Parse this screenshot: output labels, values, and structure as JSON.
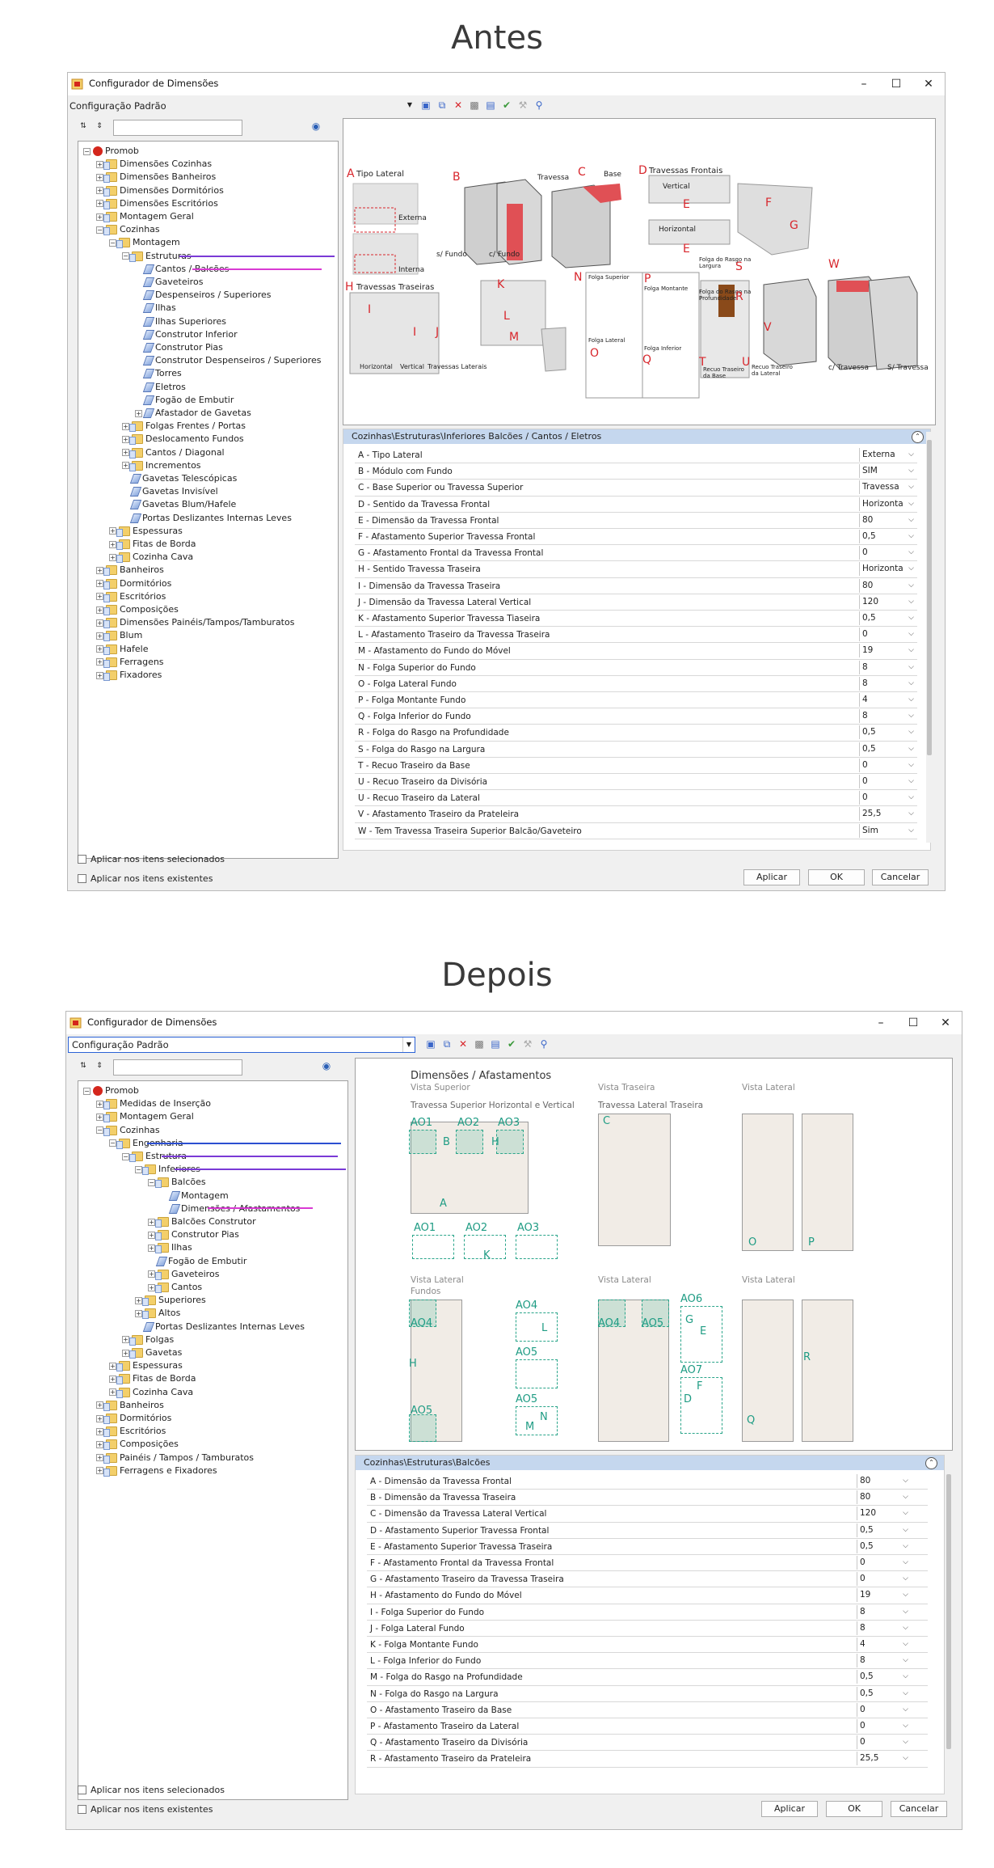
{
  "before": {
    "heading": "Antes",
    "window_title": "Configurador de Dimensões",
    "config_label": "Configuração Padrão",
    "tree": [
      {
        "label": "Promob",
        "level": 0,
        "toggle": "-",
        "icon": "root"
      },
      {
        "label": "Dimensões Cozinhas",
        "level": 1,
        "toggle": "+",
        "icon": "folder"
      },
      {
        "label": "Dimensões Banheiros",
        "level": 1,
        "toggle": "+",
        "icon": "folder"
      },
      {
        "label": "Dimensões Dormitórios",
        "level": 1,
        "toggle": "+",
        "icon": "folder"
      },
      {
        "label": "Dimensões Escritórios",
        "level": 1,
        "toggle": "+",
        "icon": "folder"
      },
      {
        "label": "Montagem Geral",
        "level": 1,
        "toggle": "+",
        "icon": "folder"
      },
      {
        "label": "Cozinhas",
        "level": 1,
        "toggle": "-",
        "icon": "folder"
      },
      {
        "label": "Montagem",
        "level": 2,
        "toggle": "-",
        "icon": "folder"
      },
      {
        "label": "Estruturas",
        "level": 3,
        "toggle": "-",
        "icon": "folder"
      },
      {
        "label": "Cantos / Balcões",
        "level": 4,
        "toggle": "",
        "icon": "leaf"
      },
      {
        "label": "Gaveteiros",
        "level": 4,
        "toggle": "",
        "icon": "leaf"
      },
      {
        "label": "Despenseiros / Superiores",
        "level": 4,
        "toggle": "",
        "icon": "leaf"
      },
      {
        "label": "Ilhas",
        "level": 4,
        "toggle": "",
        "icon": "leaf"
      },
      {
        "label": "Ilhas Superiores",
        "level": 4,
        "toggle": "",
        "icon": "leaf"
      },
      {
        "label": "Construtor Inferior",
        "level": 4,
        "toggle": "",
        "icon": "leaf"
      },
      {
        "label": "Construtor Pias",
        "level": 4,
        "toggle": "",
        "icon": "leaf"
      },
      {
        "label": "Construtor Despenseiros / Superiores",
        "level": 4,
        "toggle": "",
        "icon": "leaf"
      },
      {
        "label": "Torres",
        "level": 4,
        "toggle": "",
        "icon": "leaf"
      },
      {
        "label": "Eletros",
        "level": 4,
        "toggle": "",
        "icon": "leaf"
      },
      {
        "label": "Fogão de Embutir",
        "level": 4,
        "toggle": "",
        "icon": "leaf"
      },
      {
        "label": "Afastador de Gavetas",
        "level": 4,
        "toggle": "+",
        "icon": "leaf"
      },
      {
        "label": "Folgas Frentes / Portas",
        "level": 3,
        "toggle": "+",
        "icon": "folder"
      },
      {
        "label": "Deslocamento Fundos",
        "level": 3,
        "toggle": "+",
        "icon": "folder"
      },
      {
        "label": "Cantos / Diagonal",
        "level": 3,
        "toggle": "+",
        "icon": "folder"
      },
      {
        "label": "Incrementos",
        "level": 3,
        "toggle": "+",
        "icon": "folder"
      },
      {
        "label": "Gavetas Telescópicas",
        "level": 3,
        "toggle": "",
        "icon": "leaf"
      },
      {
        "label": "Gavetas Invisível",
        "level": 3,
        "toggle": "",
        "icon": "leaf"
      },
      {
        "label": "Gavetas Blum/Hafele",
        "level": 3,
        "toggle": "",
        "icon": "leaf"
      },
      {
        "label": "Portas Deslizantes Internas Leves",
        "level": 3,
        "toggle": "",
        "icon": "leaf"
      },
      {
        "label": "Espessuras",
        "level": 2,
        "toggle": "+",
        "icon": "folder"
      },
      {
        "label": "Fitas de Borda",
        "level": 2,
        "toggle": "+",
        "icon": "folder"
      },
      {
        "label": "Cozinha Cava",
        "level": 2,
        "toggle": "+",
        "icon": "folder"
      },
      {
        "label": "Banheiros",
        "level": 1,
        "toggle": "+",
        "icon": "folder"
      },
      {
        "label": "Dormitórios",
        "level": 1,
        "toggle": "+",
        "icon": "folder"
      },
      {
        "label": "Escritórios",
        "level": 1,
        "toggle": "+",
        "icon": "folder"
      },
      {
        "label": "Composições",
        "level": 1,
        "toggle": "+",
        "icon": "folder"
      },
      {
        "label": "Dimensões Painéis/Tampos/Tamburatos",
        "level": 1,
        "toggle": "+",
        "icon": "folder"
      },
      {
        "label": "Blum",
        "level": 1,
        "toggle": "+",
        "icon": "folder"
      },
      {
        "label": "Hafele",
        "level": 1,
        "toggle": "+",
        "icon": "folder"
      },
      {
        "label": "Ferragens",
        "level": 1,
        "toggle": "+",
        "icon": "folder"
      },
      {
        "label": "Fixadores",
        "level": 1,
        "toggle": "+",
        "icon": "folder"
      }
    ],
    "grid_header": "Cozinhas\\Estruturas\\Inferiores Balcões / Cantos / Eletros",
    "rows": [
      {
        "label": "A - Tipo Lateral",
        "value": "Externa"
      },
      {
        "label": "B - Módulo com Fundo",
        "value": "SIM"
      },
      {
        "label": "C - Base Superior ou Travessa Superior",
        "value": "Travessa"
      },
      {
        "label": "D - Sentido da Travessa Frontal",
        "value": "Horizonta"
      },
      {
        "label": "E - Dimensão da Travessa Frontal",
        "value": "80"
      },
      {
        "label": "F - Afastamento Superior Travessa Frontal",
        "value": "0,5"
      },
      {
        "label": "G - Afastamento Frontal da Travessa Frontal",
        "value": "0"
      },
      {
        "label": "H - Sentido Travessa Traseira",
        "value": "Horizonta"
      },
      {
        "label": "I - Dimensão da Travessa Traseira",
        "value": "80"
      },
      {
        "label": "J - Dimensão da Travessa Lateral Vertical",
        "value": "120"
      },
      {
        "label": "K - Afastamento Superior Travessa Tiaseira",
        "value": "0,5"
      },
      {
        "label": "L - Afastamento Traseiro da Travessa Traseira",
        "value": "0"
      },
      {
        "label": "M - Afastamento do Fundo do Móvel",
        "value": "19"
      },
      {
        "label": "N - Folga Superior do Fundo",
        "value": "8"
      },
      {
        "label": "O - Folga Lateral Fundo",
        "value": "8"
      },
      {
        "label": "P - Folga Montante Fundo",
        "value": "4"
      },
      {
        "label": "Q - Folga Inferior do Fundo",
        "value": "8"
      },
      {
        "label": "R - Folga do Rasgo na Profundidade",
        "value": "0,5"
      },
      {
        "label": "S - Folga do Rasgo na Largura",
        "value": "0,5"
      },
      {
        "label": "T - Recuo Traseiro da Base",
        "value": "0"
      },
      {
        "label": "U - Recuo Traseiro da Divisória",
        "value": "0"
      },
      {
        "label": "U - Recuo Traseiro da Lateral",
        "value": "0"
      },
      {
        "label": "V - Afastamento Traseiro da Prateleira",
        "value": "25,5"
      },
      {
        "label": "W - Tem Travessa Traseira Superior Balcão/Gaveteiro",
        "value": "Sim"
      }
    ],
    "preview": {
      "A": "A",
      "tipo_lateral": "Tipo Lateral",
      "externa": "Externa",
      "interna": "Interna",
      "B": "B",
      "s_fundo": "s/ Fundo",
      "c_fundo": "c/ Fundo",
      "C": "C",
      "travessa": "Travessa",
      "base": "Base",
      "D": "D",
      "travessas_frontais": "Travessas Frontais",
      "vertical": "Vertical",
      "horizontal": "Horizontal",
      "E1": "E",
      "E2": "E",
      "F": "F",
      "G": "G",
      "H": "H",
      "travessas_traseiras": "Travessas Traseiras",
      "I1": "I",
      "I2": "I",
      "J": "J",
      "t_horizontal": "Horizontal",
      "t_vertical": "Vertical",
      "t_laterais": "Travessas Laterais",
      "K": "K",
      "L": "L",
      "M": "M",
      "N": "N",
      "P": "P",
      "folga_superior": "Folga Superior",
      "folga_montante": "Folga Montante",
      "folga_lateral": "Folga Lateral",
      "folga_inferior": "Folga Inferior",
      "O": "O",
      "Q": "Q",
      "S": "S",
      "R": "R",
      "folga_rasgo_largura": "Folga do Rasgo na Largura",
      "folga_rasgo_prof": "Folga do Rasgo na Profundidade",
      "T": "T",
      "U": "U",
      "recuo_base": "Recuo Traseiro da Base",
      "recuo_lateral": "Recuo Traseiro da Lateral",
      "V": "V",
      "W": "W",
      "c_travessa": "c/ Travessa",
      "s_travessa": "S/ Travessa"
    },
    "check1": "Aplicar nos itens selecionados",
    "check2": "Aplicar nos itens existentes",
    "btn_apply": "Aplicar",
    "btn_ok": "OK",
    "btn_cancel": "Cancelar"
  },
  "after": {
    "heading": "Depois",
    "window_title": "Configurador de Dimensões",
    "config_label": "Configuração Padrão",
    "tree": [
      {
        "label": "Promob",
        "level": 0,
        "toggle": "-",
        "icon": "root"
      },
      {
        "label": "Medidas de Inserção",
        "level": 1,
        "toggle": "+",
        "icon": "folder"
      },
      {
        "label": "Montagem Geral",
        "level": 1,
        "toggle": "+",
        "icon": "folder"
      },
      {
        "label": "Cozinhas",
        "level": 1,
        "toggle": "-",
        "icon": "folder"
      },
      {
        "label": "Engenharia",
        "level": 2,
        "toggle": "-",
        "icon": "folder"
      },
      {
        "label": "Estrutura",
        "level": 3,
        "toggle": "-",
        "icon": "folder"
      },
      {
        "label": "Inferiores",
        "level": 4,
        "toggle": "-",
        "icon": "folder"
      },
      {
        "label": "Balcões",
        "level": 5,
        "toggle": "-",
        "icon": "folder"
      },
      {
        "label": "Montagem",
        "level": 6,
        "toggle": "",
        "icon": "leaf"
      },
      {
        "label": "Dimensões / Afastamentos",
        "level": 6,
        "toggle": "",
        "icon": "leaf"
      },
      {
        "label": "Balcões Construtor",
        "level": 5,
        "toggle": "+",
        "icon": "folder"
      },
      {
        "label": "Construtor Pias",
        "level": 5,
        "toggle": "+",
        "icon": "folder"
      },
      {
        "label": "Ilhas",
        "level": 5,
        "toggle": "+",
        "icon": "folder"
      },
      {
        "label": "Fogão de Embutir",
        "level": 5,
        "toggle": "",
        "icon": "leaf"
      },
      {
        "label": "Gaveteiros",
        "level": 5,
        "toggle": "+",
        "icon": "folder"
      },
      {
        "label": "Cantos",
        "level": 5,
        "toggle": "+",
        "icon": "folder"
      },
      {
        "label": "Superiores",
        "level": 4,
        "toggle": "+",
        "icon": "folder"
      },
      {
        "label": "Altos",
        "level": 4,
        "toggle": "+",
        "icon": "folder"
      },
      {
        "label": "Portas Deslizantes Internas Leves",
        "level": 4,
        "toggle": "",
        "icon": "leaf"
      },
      {
        "label": "Folgas",
        "level": 3,
        "toggle": "+",
        "icon": "folder"
      },
      {
        "label": "Gavetas",
        "level": 3,
        "toggle": "+",
        "icon": "folder"
      },
      {
        "label": "Espessuras",
        "level": 2,
        "toggle": "+",
        "icon": "folder"
      },
      {
        "label": "Fitas de Borda",
        "level": 2,
        "toggle": "+",
        "icon": "folder"
      },
      {
        "label": "Cozinha Cava",
        "level": 2,
        "toggle": "+",
        "icon": "folder"
      },
      {
        "label": "Banheiros",
        "level": 1,
        "toggle": "+",
        "icon": "folder"
      },
      {
        "label": "Dormitórios",
        "level": 1,
        "toggle": "+",
        "icon": "folder"
      },
      {
        "label": "Escritórios",
        "level": 1,
        "toggle": "+",
        "icon": "folder"
      },
      {
        "label": "Composições",
        "level": 1,
        "toggle": "+",
        "icon": "folder"
      },
      {
        "label": "Painéis / Tampos / Tamburatos",
        "level": 1,
        "toggle": "+",
        "icon": "folder"
      },
      {
        "label": "Ferragens e  Fixadores",
        "level": 1,
        "toggle": "+",
        "icon": "folder"
      }
    ],
    "grid_header": "Cozinhas\\Estruturas\\Balcões",
    "rows": [
      {
        "label": "A - Dimensão da Travessa Frontal",
        "value": "80"
      },
      {
        "label": "B - Dimensão da Travessa Traseira",
        "value": "80"
      },
      {
        "label": "C - Dimensão da Travessa Lateral Vertical",
        "value": "120"
      },
      {
        "label": "D - Afastamento Superior Travessa Frontal",
        "value": "0,5"
      },
      {
        "label": "E - Afastamento Superior Travessa Traseira",
        "value": "0,5"
      },
      {
        "label": "F - Afastamento Frontal da Travessa Frontal",
        "value": "0"
      },
      {
        "label": "G - Afastamento Traseiro da Travessa Traseira",
        "value": "0"
      },
      {
        "label": "H - Afastamento do Fundo do Móvel",
        "value": "19"
      },
      {
        "label": "I - Folga Superior do Fundo",
        "value": "8"
      },
      {
        "label": "J - Folga Lateral Fundo",
        "value": "8"
      },
      {
        "label": "K - Folga Montante Fundo",
        "value": "4"
      },
      {
        "label": "L - Folga Inferior do Fundo",
        "value": "8"
      },
      {
        "label": "M - Folga do Rasgo na Profundidade",
        "value": "0,5"
      },
      {
        "label": "N - Folga do Rasgo na Largura",
        "value": "0,5"
      },
      {
        "label": "O - Afastamento Traseiro da Base",
        "value": "0"
      },
      {
        "label": "P - Afastamento Traseiro da Lateral",
        "value": "0"
      },
      {
        "label": "Q - Afastamento Traseiro da Divisória",
        "value": "0"
      },
      {
        "label": "R - Afastamento Traseiro da Prateleira",
        "value": "25,5"
      }
    ],
    "preview": {
      "title": "Dimensões / Afastamentos",
      "vista_superior": "Vista Superior",
      "vista_traseira": "Vista Traseira",
      "vista_lateral": "Vista Lateral",
      "travessa_sup": "Travessa Superior Horizontal e Vertical",
      "travessa_lat": "Travessa Lateral Traseira",
      "vista_lateral_fundos": "Vista Lateral",
      "fundos": "Fundos",
      "vista_lateral2": "Vista Lateral",
      "vista_lateral3": "Vista Lateral",
      "AO1": "AO1",
      "AO2": "AO2",
      "AO3": "AO3",
      "B": "B",
      "H": "H",
      "A": "A",
      "C": "C",
      "O": "O",
      "P": "P",
      "AO1b": "AO1",
      "AO2b": "AO2",
      "AO3b": "AO3",
      "K": "K",
      "AO4": "AO4",
      "AO5": "AO5",
      "AO4b": "AO4",
      "AO5b": "AO5",
      "AO5c": "AO5",
      "AO4c": "AO4",
      "AO5d": "AO5",
      "AO6": "AO6",
      "AO7": "AO7",
      "Hb": "H",
      "G": "G",
      "E": "E",
      "D": "D",
      "F": "F",
      "Q": "Q",
      "R": "R",
      "L": "L",
      "N": "N",
      "M": "M"
    },
    "check1": "Aplicar nos itens selecionados",
    "check2": "Aplicar nos itens existentes",
    "btn_apply": "Aplicar",
    "btn_ok": "OK",
    "btn_cancel": "Cancelar"
  },
  "colors": {
    "underline_blue": "#2c4fd1",
    "underline_purple": "#7a3ad6",
    "underline_magenta": "#d93ad3",
    "accent_red": "#d8262c",
    "accent_teal": "#1f9c84",
    "grid_header": "#c5d7ee"
  }
}
